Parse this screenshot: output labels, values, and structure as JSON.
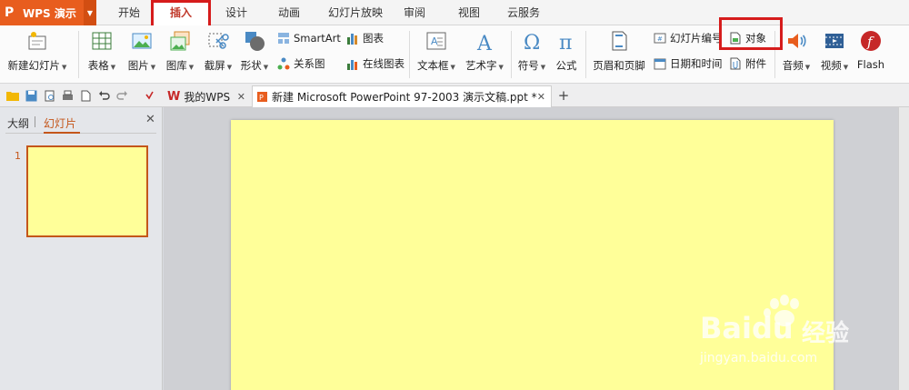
{
  "app": {
    "logo": "P",
    "title": "WPS 演示"
  },
  "menu": {
    "tabs": [
      {
        "label": "开始"
      },
      {
        "label": "插入"
      },
      {
        "label": "设计"
      },
      {
        "label": "动画"
      },
      {
        "label": "幻灯片放映"
      },
      {
        "label": "审阅"
      },
      {
        "label": "视图"
      },
      {
        "label": "云服务"
      }
    ],
    "active": "插入"
  },
  "ribbon": {
    "new_slide": "新建幻灯片",
    "table": "表格",
    "picture": "图片",
    "gallery": "图库",
    "screenshot": "截屏",
    "shapes": "形状",
    "smartart": "SmartArt",
    "chart": "图表",
    "relation_diagram": "关系图",
    "online_chart": "在线图表",
    "text_box": "文本框",
    "word_art": "艺术字",
    "symbol": "符号",
    "equation": "公式",
    "header_footer": "页眉和页脚",
    "slide_number": "幻灯片编号",
    "object": "对象",
    "date_time": "日期和时间",
    "attachment": "附件",
    "audio": "音频",
    "video": "视频",
    "flash": "Flash"
  },
  "doctabs": [
    {
      "label": "我的WPS"
    },
    {
      "label": "新建 Microsoft PowerPoint 97-2003 演示文稿.ppt *"
    }
  ],
  "leftpanel": {
    "tabs": [
      "大纲",
      "幻灯片"
    ],
    "active": "幻灯片",
    "slide_numbers": [
      "1"
    ]
  },
  "watermark": {
    "brand": "Baidu",
    "sub": "经验",
    "url": "jingyan.baidu.com"
  },
  "colors": {
    "accent": "#e85d1e",
    "highlight_box": "#d61c1c",
    "slide_background": "#ffff99",
    "active_tab_text": "#c0392b"
  }
}
